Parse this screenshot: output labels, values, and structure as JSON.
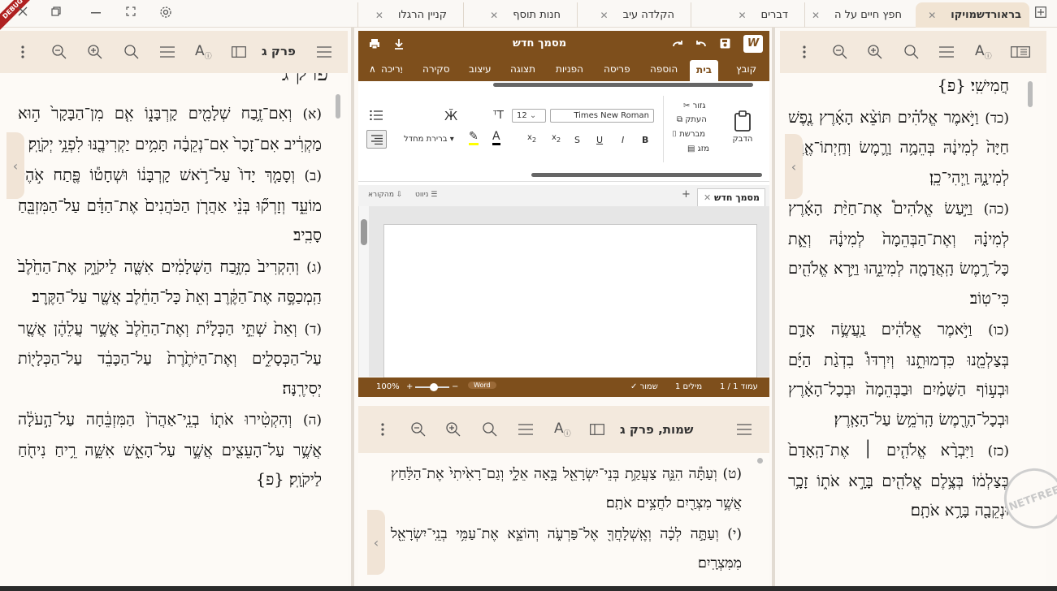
{
  "colors": {
    "accent": "#7e4f1c",
    "pane_header": "#f3e9dd",
    "active_tab": "#f1e4d3",
    "badge": "#b02121"
  },
  "debug_badge": "DEBUG",
  "tabs": [
    {
      "label": "בראורדשמויקו",
      "active": true
    },
    {
      "label": "חפץ חיים על ה",
      "active": false
    },
    {
      "label": "דברים",
      "active": false
    },
    {
      "label": "הקלדה עיב",
      "active": false
    },
    {
      "label": "חנות תוסף",
      "active": false
    },
    {
      "label": "קניין הרגלו",
      "active": false
    }
  ],
  "left_pane": {
    "title": "פרק ג",
    "header_partial": "פרק ג",
    "verses": [
      {
        "num": "(א)",
        "text": "וְאִם־זֶ֥בַח שְׁלָמִ֖ים קָרְבָּנ֑וֹ אִ֤ם מִן־הַבָּקָר֙ ה֣וּא מַקְרִ֔יב אִם־זָכָר֙ אִם־נְקֵבָ֔ה תָּמִ֥ים יַקְרִיבֶ֖נּוּ לִפְנֵ֥י יְקֹוָֽק׃"
      },
      {
        "num": "(ב)",
        "text": "וְסָמַ֤ךְ יָדוֹ֙ עַל־רֹ֣אשׁ קָרְבָּנ֔וֹ וּשְׁחָט֕וֹ פֶּ֖תַח אֹ֣הֶל מוֹעֵ֑ד וְזָרְק֞וּ בְּנֵ֨י אַהֲרֹ֤ן הַכֹּהֲנִים֙ אֶת־הַדָּ֔ם עַל־הַמִּזְבֵּ֖חַ סָבִֽיב׃"
      },
      {
        "num": "(ג)",
        "text": "וְהִקְרִיב֙ מִזֶּ֣בַח הַשְּׁלָמִ֔ים אִשֶּׁ֖ה לַיקֹוָ֑ק אֶת־הַחֵ֙לֶב֙ הַֽמְכַסֶּ֣ה אֶת־הַקֶּ֔רֶב וְאֵת֙ כָּל־הַחֵ֔לֶב אֲשֶׁ֖ר עַל־הַקֶּֽרֶב׃"
      },
      {
        "num": "(ד)",
        "text": "וְאֵת֙ שְׁתֵּ֣י הַכְּלָיֹ֔ת וְאֶת־הַחֵ֙לֶב֙ אֲשֶׁ֣ר עֲלֵהֶ֔ן אֲשֶׁ֖ר עַל־הַכְּסָלִ֑ים וְאֶת־הַיֹּתֶ֙רֶת֙ עַל־הַכָּבֵ֔ד עַל־הַכְּלָי֖וֹת יְסִירֶֽנָּה׃"
      },
      {
        "num": "(ה)",
        "text": "וְהִקְטִ֨ירוּ אֹת֤וֹ בְנֵֽי־אַהֲרֹן֙ הַמִּזְבֵּ֔חָה עַל־הָ֣עֹלָ֔ה אֲשֶׁ֥ר עַל־הָעֵצִ֖ים אֲשֶׁ֣ר עַל־הָאֵ֑שׁ אִשֵּׁ֛ה רֵ֥יחַ נִיחֹ֖חַ לַיקֹוָֽק׃ {פ}"
      }
    ]
  },
  "word_processor": {
    "title": "מסמך חדש",
    "logo": "W",
    "menu": [
      "קובץ",
      "בית",
      "הוספה",
      "פריסה",
      "הפניות",
      "תצוגה",
      "עיצוב",
      "סקירה",
      "עריכה"
    ],
    "active_menu": "בית",
    "clipboard": {
      "paste": "הדבק",
      "cut": "גזור",
      "copy": "העתק",
      "format_painter": "מברשת",
      "merge": "מזג"
    },
    "font_name": "Times New Roman",
    "font_size": "12",
    "styles_label": "ברירת מחדל",
    "doc_tab": "מסמך חדש",
    "toolbar_view": "ניווט",
    "toolbar_source": "מהקורא",
    "status": {
      "page": "עמוד 1 / 1",
      "words": "1 מילים",
      "saved": "✓ שמור",
      "word": "Word",
      "zoom": "100%"
    }
  },
  "middle_lower_pane": {
    "title": "שמות, פרק ג",
    "verses": [
      {
        "num": "(ט)",
        "text": "וְעַתָּ֕ה הִנֵּ֛ה צַעֲקַ֥ת בְּנֵי־יִשְׂרָאֵ֖ל בָּ֣אָה אֵלָ֑י וְגַם־רָאִ֙יתִי֙ אֶת־הַלַּ֔חַץ אֲשֶׁ֥ר מִצְרַ֖יִם לֹחֲצִ֥ים אֹתָֽם׃"
      },
      {
        "num": "(י)",
        "text": "וְעַתָּ֣ה לְכָ֔ה וְאֶֽשְׁלָחֲךָ֖ אֶל־פַּרְעֹ֑ה וְהוֹצֵ֛א אֶת־עַמִּ֥י בְנֵֽי־יִשְׂרָאֵ֖ל מִמִּצְרָֽיִם׃"
      }
    ]
  },
  "right_pane": {
    "verses": [
      {
        "num": "",
        "text": "חֲמִישִֽׁי׃ {פ}"
      },
      {
        "num": "(כד)",
        "text": "וַיֹּ֣אמֶר אֱלֹהִ֗ים תּוֹצֵ֨א הָאָ֜רֶץ נֶ֤פֶשׁ חַיָּה֙ לְמִינָ֔הּ בְּהֵמָ֥ה וָרֶ֛מֶשׂ וְחַֽיְתוֹ־אֶ֖רֶץ לְמִינָ֑הּ וַֽיְהִי־כֵֽן׃"
      },
      {
        "num": "(כה)",
        "text": "וַיַּ֣עַשׂ אֱלֹהִים֩ אֶת־חַיַּ֨ת הָאָ֜רֶץ לְמִינָ֗הּ וְאֶת־הַבְּהֵמָה֙ לְמִינָ֔הּ וְאֵ֛ת כָּל־רֶ֥מֶשׂ הָֽאֲדָמָ֖ה לְמִינֵ֑הוּ וַיַּ֥רְא אֱלֹהִ֖ים כִּי־טֽוֹב׃"
      },
      {
        "num": "(כו)",
        "text": "וַיֹּ֣אמֶר אֱלֹהִ֔ים נַֽעֲשֶׂ֥ה אָדָ֛ם בְּצַלְמֵ֖נוּ כִּדְמוּתֵ֑נוּ וְיִרְדּוּ֩ בִדְגַ֨ת הַיָּ֜ם וּבְע֣וֹף הַשָּׁמַ֗יִם וּבַבְּהֵמָה֙ וּבְכָל־הָאָ֔רֶץ וּבְכָל־הָרֶ֖מֶשׂ הָֽרֹמֵ֥שׂ עַל־הָאָֽרֶץ׃"
      },
      {
        "num": "(כז)",
        "text": "וַיִּבְרָ֨א אֱלֹהִ֤ים ׀ אֶת־הָֽאָדָם֙ בְּצַלְמ֔וֹ בְּצֶ֥לֶם אֱלֹהִ֖ים בָּרָ֣א אֹת֑וֹ זָכָ֥ר וּנְקֵבָ֖ה בָּרָ֥א אֹתָֽם׃"
      }
    ]
  },
  "watermark": "NETFREE"
}
